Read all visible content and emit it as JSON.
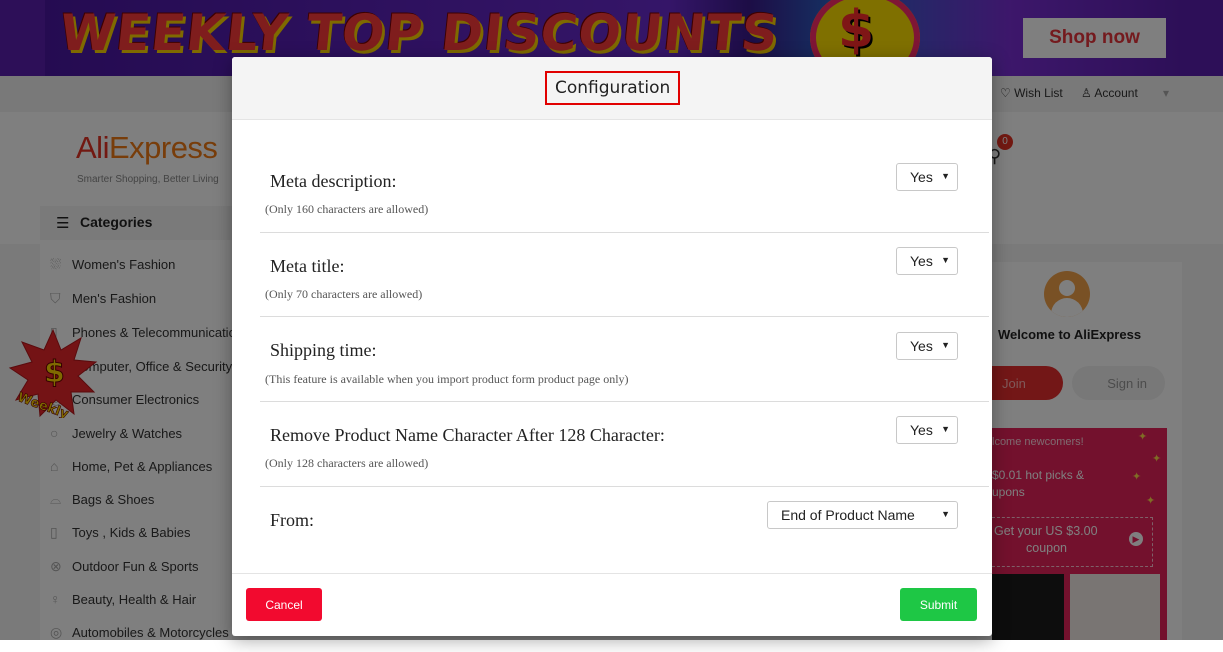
{
  "banner": {
    "title": "WEEKLY TOP DISCOUNTS",
    "shop_button": "Shop now"
  },
  "topnav": {
    "wishlist": "♡ Wish List",
    "account": "♙ Account",
    "account_caret": "▾"
  },
  "header": {
    "logo_ali": "Ali",
    "logo_express": "Express",
    "tagline": "Smarter Shopping, Better Living",
    "cart_count": "0",
    "categories_label": "Categories"
  },
  "categories": [
    {
      "icon": "dress-icon",
      "glyph": "⛆",
      "label": "Women's Fashion"
    },
    {
      "icon": "shirt-icon",
      "glyph": "⛉",
      "label": "Men's Fashion"
    },
    {
      "icon": "phone-icon",
      "glyph": "▯",
      "label": "Phones & Telecommunications"
    },
    {
      "icon": "computer-icon",
      "glyph": "▭",
      "label": "Computer, Office & Security"
    },
    {
      "icon": "consumer-electronics-icon",
      "glyph": "◎",
      "label": "Consumer Electronics"
    },
    {
      "icon": "jewelry-icon",
      "glyph": "○",
      "label": "Jewelry & Watches"
    },
    {
      "icon": "home-icon",
      "glyph": "⌂",
      "label": "Home, Pet & Appliances"
    },
    {
      "icon": "bag-icon",
      "glyph": "⌓",
      "label": "Bags & Shoes"
    },
    {
      "icon": "toy-icon",
      "glyph": "▯",
      "label": "Toys , Kids & Babies"
    },
    {
      "icon": "ball-icon",
      "glyph": "⊗",
      "label": "Outdoor Fun & Sports"
    },
    {
      "icon": "beauty-icon",
      "glyph": "♀",
      "label": "Beauty, Health & Hair"
    },
    {
      "icon": "car-icon",
      "glyph": "◎",
      "label": "Automobiles & Motorcycles"
    }
  ],
  "weekly_badge": {
    "text": "Weekly"
  },
  "side_panel": {
    "welcome": "Welcome to AliExpress",
    "join": "Join",
    "sign_in": "Sign in",
    "promo_line1": "lcome newcomers!",
    "promo_line2": "$0.01 hot picks &",
    "promo_line3": "upons",
    "coupon_line1": "Get your US $3.00",
    "coupon_line2": "coupon"
  },
  "modal": {
    "title": "Configuration",
    "rows": [
      {
        "label": "Meta description:",
        "note": "(Only 160 characters are allowed)",
        "value": "Yes"
      },
      {
        "label": "Meta title:",
        "note": "(Only 70 characters are allowed)",
        "value": "Yes"
      },
      {
        "label": "Shipping time:",
        "note": "(This feature is available when you import product form product page only)",
        "value": "Yes"
      },
      {
        "label": "Remove Product Name Character After 128 Character:",
        "note": "(Only 128 characters are allowed)",
        "value": "Yes"
      },
      {
        "label": "From:",
        "note": "",
        "value": "End of Product Name"
      }
    ],
    "cancel": "Cancel",
    "submit": "Submit"
  },
  "colors": {
    "cancel": "#f20a2f",
    "submit": "#1ec745",
    "highlight": "#e10000",
    "brand_red": "#e43225"
  }
}
